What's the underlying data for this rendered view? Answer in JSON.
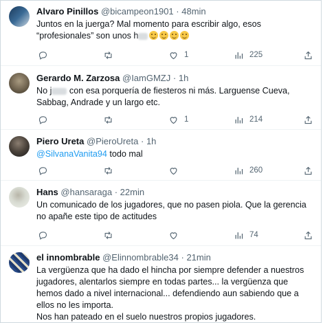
{
  "tweets": [
    {
      "name": "Alvaro Pinillos",
      "handle": "@bicampeon1901",
      "time": "48min",
      "text_main": "Juntos en la juerga? Mal momento para escribir algo, esos “profesionales” son unos h",
      "text_tail": "",
      "replies": "",
      "retweets": "",
      "likes": "1",
      "views": "225",
      "avatar_colors": [
        "#1b3a5c",
        "#c9d6e0"
      ]
    },
    {
      "name": "Gerardo M. Zarzosa",
      "handle": "@IamGMZJ",
      "time": "1h",
      "text_main": "No j",
      "text_tail": " con esa porquería de fiesteros ni más. Larguense Cueva, Sabbag, Andrade y un largo etc.",
      "replies": "",
      "retweets": "",
      "likes": "1",
      "views": "214",
      "avatar_colors": [
        "#5a5040",
        "#a89a80"
      ]
    },
    {
      "name": "Piero Ureta",
      "handle": "@PieroUreta",
      "time": "1h",
      "mention": "@SilvanaVanita94",
      "text_tail": " todo mal",
      "replies": "",
      "retweets": "",
      "likes": "",
      "views": "260",
      "avatar_colors": [
        "#2e2e2e",
        "#8a7d70"
      ]
    },
    {
      "name": "Hans",
      "handle": "@hansaraga",
      "time": "22min",
      "text_main": "Un comunicado de los jugadores, que no pasen piola. Que la gerencia no apañe este tipo de actitudes",
      "replies": "",
      "retweets": "",
      "likes": "",
      "views": "74",
      "avatar_colors": [
        "#d8dbd2",
        "#9aa08a"
      ]
    },
    {
      "name": "el innombrable",
      "handle": "@Elinnombrable34",
      "time": "21min",
      "text_main": "La vergüenza que ha dado el hincha por siempre defender a nuestros jugadores, alentarlos siempre en todas partes... la vergüenza que hemos dado a nivel internacional... defendiendo aun sabiendo que a ellos no les importa.",
      "text_line2": "Nos han pateado en el suelo nuestros propios jugadores.",
      "avatar_colors": [
        "#1f3b6e",
        "#e6e0c8"
      ]
    }
  ],
  "ui": {
    "dot": "·"
  },
  "icons": [
    "reply-icon",
    "retweet-icon",
    "like-icon",
    "views-icon",
    "share-icon"
  ]
}
